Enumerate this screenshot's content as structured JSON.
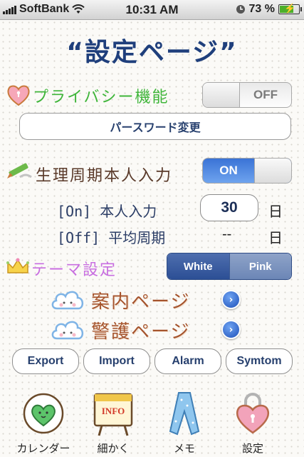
{
  "status_bar": {
    "carrier": "SoftBank",
    "time": "10:31 AM",
    "battery": "73 %",
    "battery_level": 0.73
  },
  "title": "“設定ページ”",
  "privacy": {
    "label": "プライバシー機能",
    "toggle": "OFF",
    "password_button": "パースワード変更"
  },
  "cycle": {
    "label": "生理周期本人入力",
    "toggle": "ON",
    "on_label": "[On] 本人入力",
    "on_value": "30",
    "on_unit": "日",
    "off_label": "[Off] 平均周期",
    "off_value": "--",
    "off_unit": "日"
  },
  "theme": {
    "label": "テーマ設定",
    "options": [
      "White",
      "Pink"
    ],
    "selected": "White"
  },
  "links": [
    {
      "label": "案内ページ"
    },
    {
      "label": "警護ページ"
    }
  ],
  "buttons": [
    "Export",
    "Import",
    "Alarm",
    "Symtom"
  ],
  "tabbar": [
    {
      "label": "カレンダー",
      "icon": "heart-icon"
    },
    {
      "label": "細かく",
      "icon": "info-board-icon",
      "badge": "INFO"
    },
    {
      "label": "メモ",
      "icon": "ribbon-icon"
    },
    {
      "label": "設定",
      "icon": "heart-lock-icon"
    }
  ],
  "colors": {
    "title": "#1f3f7c",
    "privacy_label": "#3fb53a",
    "cycle_label": "#5a3a2a",
    "theme_label": "#c86ee0",
    "link_label": "#a5542d",
    "toggle_on": "#3a73d6"
  }
}
